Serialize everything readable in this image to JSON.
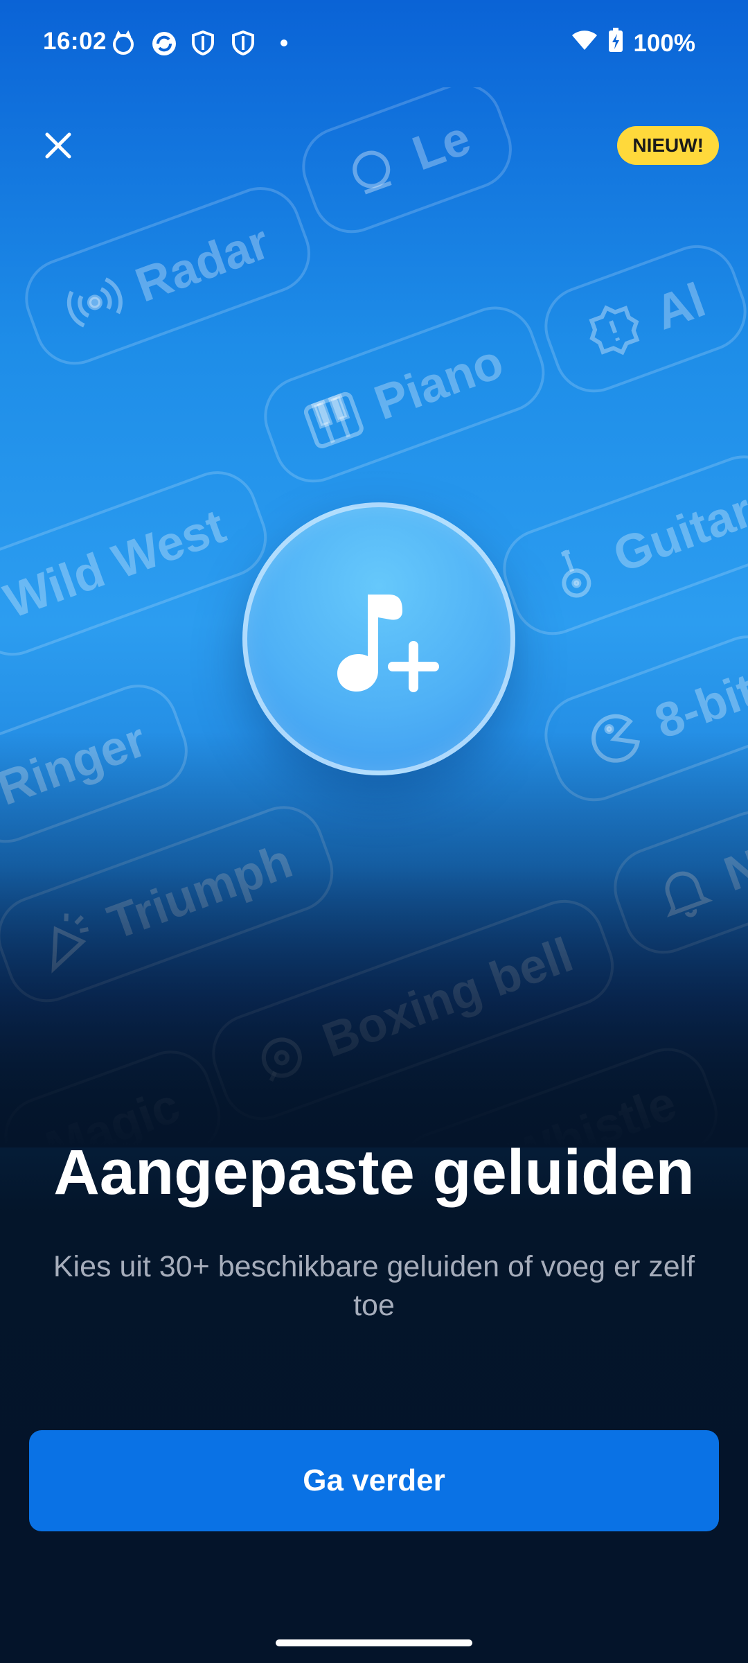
{
  "status_bar": {
    "time": "16:02",
    "battery": "100%",
    "icons": [
      "cat-notification-icon",
      "sync-notification-icon",
      "shield-notification-icon",
      "shield-notification-icon",
      "dot-icon",
      "wifi-icon",
      "battery-charging-icon"
    ]
  },
  "header": {
    "close_icon": "close-icon",
    "badge": "NIEUW!"
  },
  "sounds": [
    {
      "label": "Radar",
      "icon": "radar-icon"
    },
    {
      "label": "Piano",
      "icon": "piano-icon"
    },
    {
      "label": "Wild West",
      "icon": ""
    },
    {
      "label": "Guitar",
      "icon": "guitar-icon"
    },
    {
      "label": "Ringer",
      "icon": ""
    },
    {
      "label": "8-bit",
      "icon": "pacman-icon"
    },
    {
      "label": "Triumph",
      "icon": "party-horn-icon"
    },
    {
      "label": "Boxing bell",
      "icon": "bell-icon"
    },
    {
      "label": "Magic",
      "icon": ""
    },
    {
      "label": "Whistle",
      "icon": "whistle-icon"
    },
    {
      "label": "Le",
      "icon": "alarm-bell-icon"
    },
    {
      "label": "Al",
      "icon": "alert-icon"
    },
    {
      "label": "N",
      "icon": "notification-bell-icon"
    }
  ],
  "hero_icon": "music-note-plus-icon",
  "content": {
    "title": "Aangepaste geluiden",
    "subtitle": "Kies uit 30+ beschikbare geluiden of voeg er zelf toe",
    "continue_label": "Ga verder"
  },
  "colors": {
    "accent": "#0a72e5",
    "badge": "#ffd93b",
    "background_dark": "#04142a"
  }
}
